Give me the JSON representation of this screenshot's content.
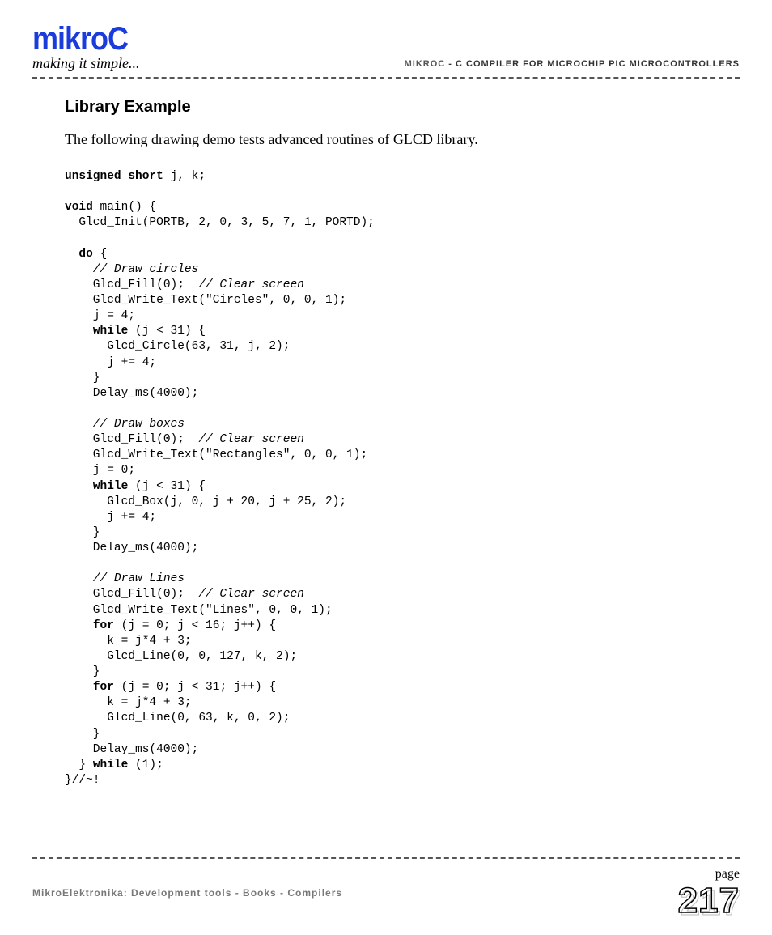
{
  "header": {
    "logo": "mikroC",
    "tagline": "making it simple...",
    "right_brand": "mikroC",
    "right_text": " - C Compiler for Microchip PIC microcontrollers"
  },
  "section_title": "Library Example",
  "intro": "The following drawing demo tests advanced routines of GLCD library.",
  "code": {
    "l01a": "unsigned short",
    "l01b": " j, k;",
    "l02a": "void",
    "l02b": " main() {",
    "l03": "  Glcd_Init(PORTB, 2, 0, 3, 5, 7, 1, PORTD);",
    "l04a": "  ",
    "l04b": "do",
    "l04c": " {",
    "l05": "// Draw circles",
    "l06a": "    Glcd_Fill(0);  ",
    "l06b": "// Clear screen",
    "l07": "    Glcd_Write_Text(\"Circles\", 0, 0, 1);",
    "l08": "    j = 4;",
    "l09a": "    ",
    "l09b": "while",
    "l09c": " (j < 31) {",
    "l10": "      Glcd_Circle(63, 31, j, 2);",
    "l11": "      j += 4;",
    "l12": "    }",
    "l13": "    Delay_ms(4000);",
    "l14": "// Draw boxes",
    "l15a": "    Glcd_Fill(0);  ",
    "l15b": "// Clear screen",
    "l16": "    Glcd_Write_Text(\"Rectangles\", 0, 0, 1);",
    "l17": "    j = 0;",
    "l18a": "    ",
    "l18b": "while",
    "l18c": " (j < 31) {",
    "l19": "      Glcd_Box(j, 0, j + 20, j + 25, 2);",
    "l20": "      j += 4;",
    "l21": "    }",
    "l22": "    Delay_ms(4000);",
    "l23": "// Draw Lines",
    "l24a": "    Glcd_Fill(0);  ",
    "l24b": "// Clear screen",
    "l25": "    Glcd_Write_Text(\"Lines\", 0, 0, 1);",
    "l26a": "    ",
    "l26b": "for",
    "l26c": " (j = 0; j < 16; j++) {",
    "l27": "      k = j*4 + 3;",
    "l28": "      Glcd_Line(0, 0, 127, k, 2);",
    "l29": "    }",
    "l30a": "    ",
    "l30b": "for",
    "l30c": " (j = 0; j < 31; j++) {",
    "l31": "      k = j*4 + 3;",
    "l32": "      Glcd_Line(0, 63, k, 0, 2);",
    "l33": "    }",
    "l34": "    Delay_ms(4000);",
    "l35a": "  } ",
    "l35b": "while",
    "l35c": " (1);",
    "l36": "}//~!"
  },
  "footer": {
    "left": "MikroElektronika: Development tools - Books - Compilers",
    "page_label": "page",
    "page_num": "217"
  }
}
